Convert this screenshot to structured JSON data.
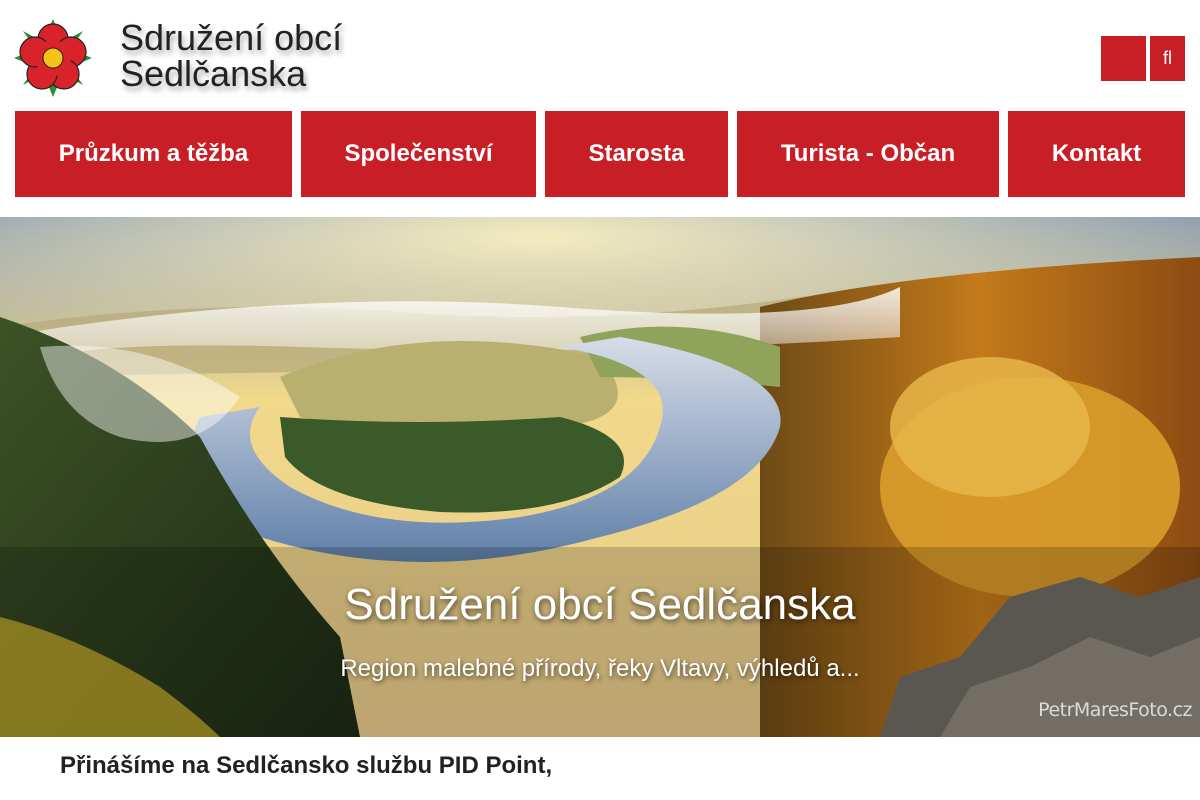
{
  "header": {
    "title_line1": "Sdružení obcí",
    "title_line2": "Sedlčanska",
    "logo_icon": "rose-coat-of-arms-icon",
    "user_icon": "user-icon",
    "search_icon": "search-icon",
    "user_glyph": "",
    "search_glyph": "fl"
  },
  "nav": {
    "items": [
      {
        "label": "Průzkum a těžba"
      },
      {
        "label": "Společenství"
      },
      {
        "label": "Starosta"
      },
      {
        "label": "Turista - Občan"
      },
      {
        "label": "Kontakt"
      }
    ]
  },
  "hero": {
    "title": "Sdružení obcí Sedlčanska",
    "subtitle": "Region malebné přírody, řeky Vltavy, výhledů a...",
    "watermark": "PetrMaresFoto.cz"
  },
  "news": {
    "headline": "Přinášíme na Sedlčansko službu PID Point,"
  },
  "colors": {
    "brand_red": "#c81f27",
    "text_dark": "#222222",
    "white": "#ffffff"
  }
}
